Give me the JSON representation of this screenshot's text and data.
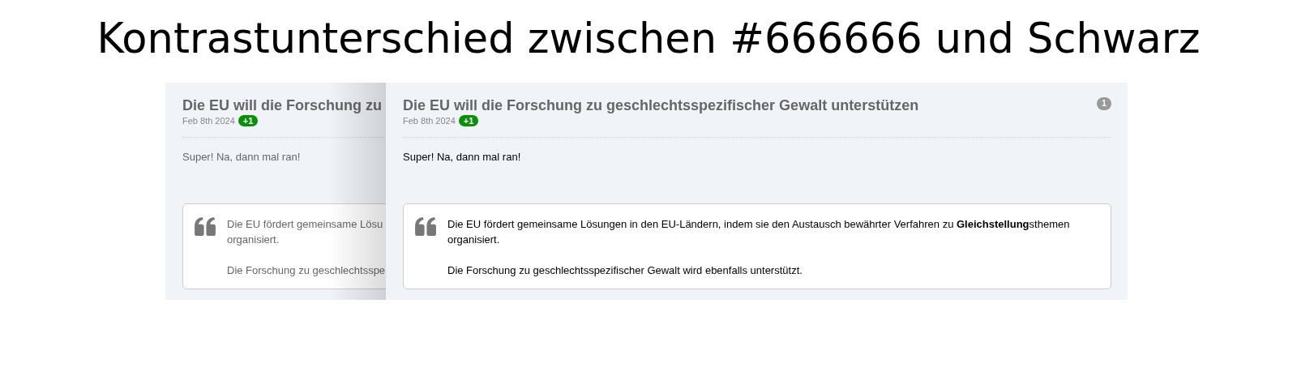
{
  "heading": "Kontrastunterschied zwischen #666666 und Schwarz",
  "cards": [
    {
      "muted": true,
      "title": "Die EU will die Forschung zu",
      "date": "Feb 8th 2024",
      "badge": "+1",
      "comment": "Super! Na, dann mal ran!",
      "quote": [
        "Die EU fördert gemeinsame Lösu",
        "organisiert.",
        "Die Forschung zu geschlechtsspe"
      ]
    },
    {
      "muted": false,
      "title": "Die EU will die Forschung zu geschlechtsspezifischer Gewalt unterstützen",
      "date": "Feb 8th 2024",
      "badge": "+1",
      "counter": "1",
      "comment": "Super! Na, dann mal ran!",
      "quote": [
        "Die EU fördert gemeinsame Lösungen in den EU-Ländern, indem sie den Austausch bewährter Verfahren zu **Gleichstellung**sthemen",
        "organisiert.",
        "Die Forschung zu geschlechtsspezifischer Gewalt wird ebenfalls unterstützt."
      ]
    }
  ]
}
